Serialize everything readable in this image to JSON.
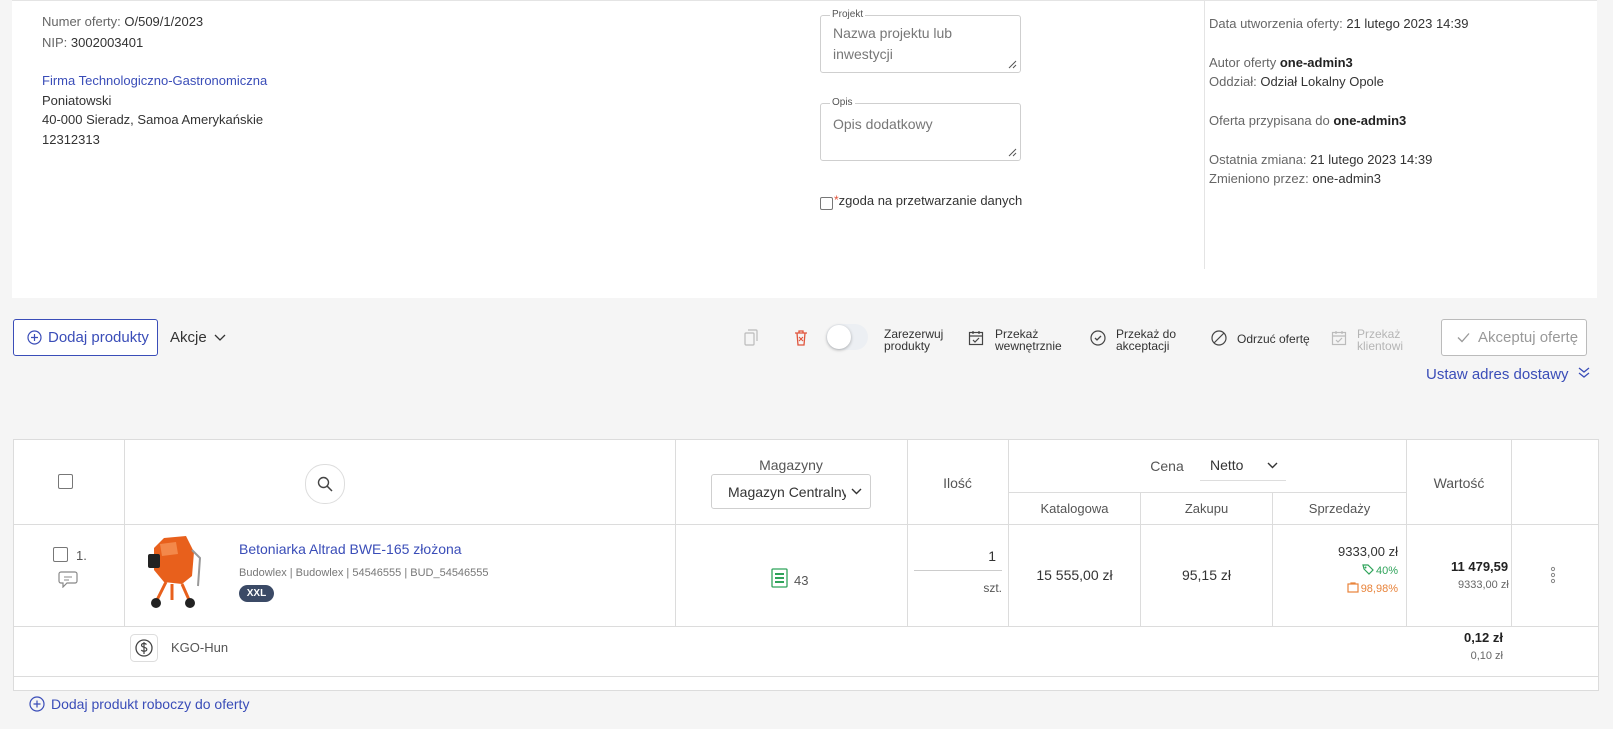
{
  "offer": {
    "number_label": "Numer oferty:",
    "number_value": "O/509/1/2023",
    "nip_label": "NIP:",
    "nip_value": "3002003401",
    "company": "Firma Technologiczno-Gastronomiczna",
    "contact_name": "Poniatowski",
    "address": "40-000 Sieradz, Samoa Amerykańskie",
    "phone": "12312313"
  },
  "form": {
    "project_label": "Projekt",
    "project_placeholder": "Nazwa projektu lub inwestycji",
    "description_label": "Opis",
    "description_placeholder": "Opis dodatkowy",
    "consent_required_mark": "*",
    "consent_label": "zgoda na przetwarzanie danych"
  },
  "meta": {
    "created_label": "Data utworzenia oferty:",
    "created_value": "21 lutego 2023 14:39",
    "author_label": "Autor oferty",
    "author_value": "one-admin3",
    "branch_label": "Oddział:",
    "branch_value": "Odział Lokalny Opole",
    "assigned_label": "Oferta przypisana do",
    "assigned_value": "one-admin3",
    "changed_label": "Ostatnia zmiana:",
    "changed_value": "21 lutego 2023 14:39",
    "changed_by_label": "Zmieniono przez:",
    "changed_by_value": "one-admin3"
  },
  "toolbar": {
    "add_products": "Dodaj produkty",
    "actions": "Akcje",
    "reserve_line1": "Zarezerwuj",
    "reserve_line2": "produkty",
    "internal_line1": "Przekaż",
    "internal_line2": "wewnętrznie",
    "accept_transfer_line1": "Przekaż do",
    "accept_transfer_line2": "akceptacji",
    "reject": "Odrzuć ofertę",
    "to_client_line1": "Przekaż",
    "to_client_line2": "klientowi",
    "accept_offer": "Akceptuj ofertę",
    "delivery_address": "Ustaw adres dostawy"
  },
  "table": {
    "warehouses_header": "Magazyny",
    "warehouse_selected": "Magazyn Centralny",
    "quantity_header": "Ilość",
    "price_header": "Cena",
    "price_mode": "Netto",
    "catalog_header": "Katalogowa",
    "purchase_header": "Zakupu",
    "sale_header": "Sprzedaży",
    "value_header": "Wartość",
    "rows": [
      {
        "index": "1.",
        "name": "Betoniarka Altrad BWE-165 złożona",
        "meta": "Budowlex | Budowlex | 54546555 | BUD_54546555",
        "badge": "XXL",
        "stock": "43",
        "quantity": "1",
        "unit": "szt.",
        "catalog_price": "15 555,00 zł",
        "purchase_price": "95,15 zł",
        "sale_price": "9333,00 zł",
        "discount": "40%",
        "margin": "98,98%",
        "value_main": "11 479,59 zł",
        "value_sub": "9333,00 zł"
      }
    ],
    "fee_name": "KGO-Hun",
    "fee_value": "0,12 zł",
    "fee_sub": "0,10 zł"
  },
  "footer": {
    "add_draft": "Dodaj produkt roboczy do oferty"
  },
  "colors": {
    "accent": "#3a4db8",
    "danger": "#e0533a",
    "success": "#2fa35a",
    "warning": "#e8833a",
    "product_orange": "#e8601c"
  }
}
